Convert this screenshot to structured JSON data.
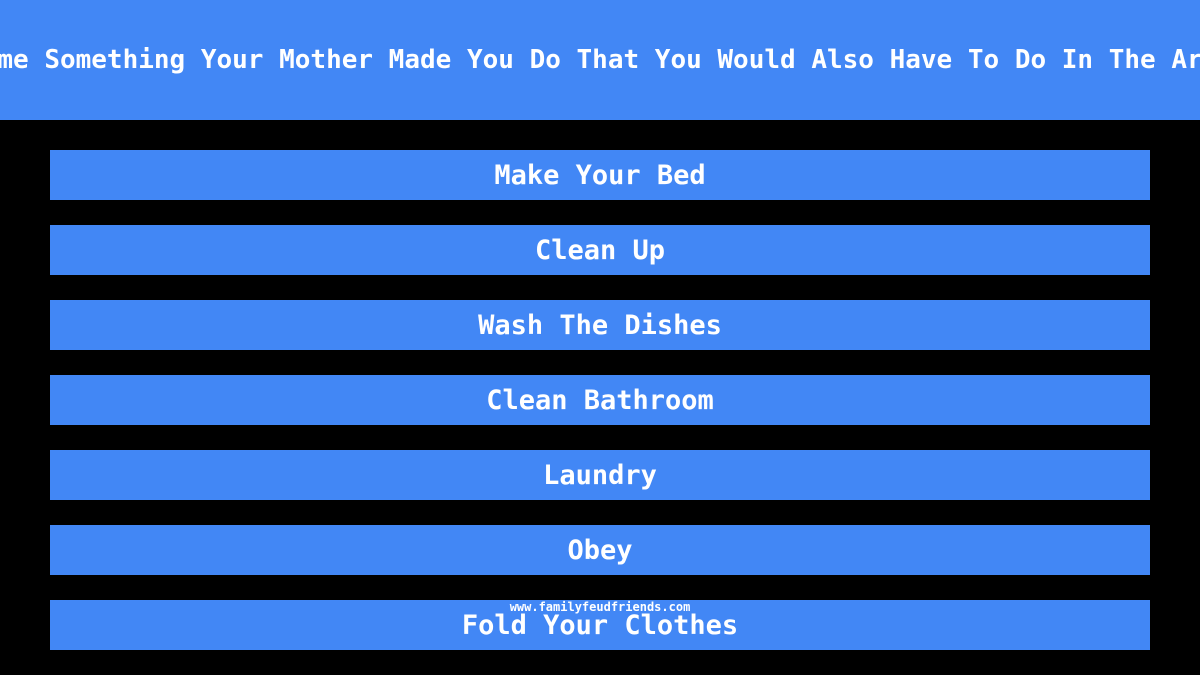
{
  "header": {
    "title": "Name Something Your Mother Made You Do That You Would Also Have To Do In The Army"
  },
  "answers": [
    {
      "label": "Make Your Bed"
    },
    {
      "label": "Clean Up"
    },
    {
      "label": "Wash The Dishes"
    },
    {
      "label": "Clean Bathroom"
    },
    {
      "label": "Laundry"
    },
    {
      "label": "Obey"
    },
    {
      "label": "Fold Your Clothes"
    }
  ],
  "watermark": "www.familyfeudfriends.com",
  "colors": {
    "accent": "#4287f5",
    "background": "#000000",
    "text": "#ffffff"
  }
}
